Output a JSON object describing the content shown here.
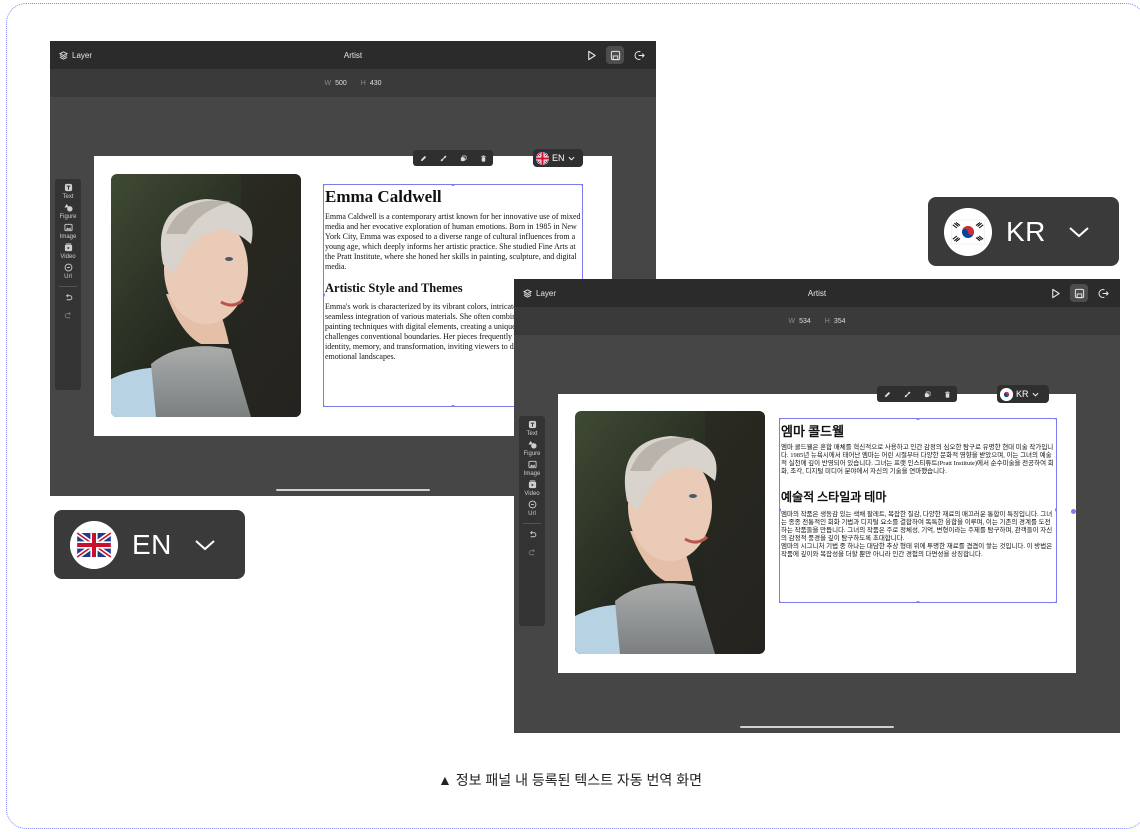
{
  "caption": "▲ 정보 패널 내 등록된 텍스트 자동 번역 화면",
  "colors": {
    "window_bg": "#464646",
    "topbar": "#2b2b2b",
    "selection": "#7c7cf0",
    "badge_bg": "#3a3a3a"
  },
  "editor_en": {
    "layer_label": "Layer",
    "title": "Artist",
    "icons": [
      "layer-icon",
      "play-icon",
      "save-icon",
      "exit-icon"
    ],
    "dims": {
      "w_label": "W",
      "w": "500",
      "h_label": "H",
      "h": "430"
    },
    "tools": [
      {
        "label": "Text",
        "icon": "text-tool-icon"
      },
      {
        "label": "Figure",
        "icon": "figure-tool-icon"
      },
      {
        "label": "Image",
        "icon": "image-tool-icon"
      },
      {
        "label": "Video",
        "icon": "video-tool-icon"
      },
      {
        "label": "Url",
        "icon": "url-tool-icon"
      }
    ],
    "lang": "EN",
    "heading": "Emma Caldwell",
    "bio": "Emma Caldwell is a contemporary artist known for her innovative use of mixed media and her evocative exploration of human emotions. Born in 1985 in New York City, Emma was exposed to a diverse range of cultural influences from a young age, which deeply informs her artistic practice. She studied Fine Arts at the Pratt Institute, where she honed her skills in painting, sculpture, and digital media.",
    "subheading": "Artistic Style and Themes",
    "style_text": "Emma's work is characterized by its vibrant colors, intricate textures, and the seamless integration of various materials. She often combines traditional painting techniques with digital elements, creating a unique fusion that challenges conventional boundaries. Her pieces frequently explore themes of identity, memory, and transformation, inviting viewers to delve into their own emotional landscapes."
  },
  "editor_kr": {
    "layer_label": "Layer",
    "title": "Artist",
    "dims": {
      "w_label": "W",
      "w": "534",
      "h_label": "H",
      "h": "354"
    },
    "tools": [
      {
        "label": "Text",
        "icon": "text-tool-icon"
      },
      {
        "label": "Figure",
        "icon": "figure-tool-icon"
      },
      {
        "label": "Image",
        "icon": "image-tool-icon"
      },
      {
        "label": "Video",
        "icon": "video-tool-icon"
      },
      {
        "label": "Url",
        "icon": "url-tool-icon"
      }
    ],
    "lang": "KR",
    "heading": "엠마 콜드웰",
    "bio": "엠마 콜드웰은 혼합 매체를 혁신적으로 사용하고 인간 감정의 심오한 탐구로 유명한 현대 미술 작가입니다. 1985년 뉴욕시에서 태어난 엠마는 어린 시절부터 다양한 문화적 영향을 받았으며, 이는 그녀의 예술적 실천에 깊이 반영되어 있습니다. 그녀는 프랫 인스티튜트(Pratt Institute)에서 순수미술을 전공하여 회화, 조각, 디지털 미디어 분야에서 자신의 기술을 연마했습니다.",
    "subheading": "예술적 스타일과 테마",
    "style_text": "엠마의 작품은 생동감 있는 색채 팔레트, 복잡한 질감, 다양한 재료의 매끄러운 통합이 특징입니다. 그녀는 종종 전통적인 회화 기법과 디지털 요소를 결합하여 독특한 융합을 이루며, 이는 기존의 경계를 도전하는 작품들을 만듭니다. 그녀의 작품은 주로 정체성, 기억, 변형이라는 주제를 탐구하며, 관객들이 자신의 감정적 풍경을 깊이 탐구하도록 초대합니다.",
    "style_text_2": "엠마의 시그니처 기법 중 하나는 대담한 추상 형태 위에 투명한 재료를 겹겹이 쌓는 것입니다. 이 방법은 작품에 깊이와 복잡성을 더할 뿐만 아니라 인간 경험의 다면성을 상징합니다."
  },
  "badge_en": {
    "code": "EN",
    "flag": "uk-flag-icon"
  },
  "badge_kr": {
    "code": "KR",
    "flag": "korea-flag-icon"
  }
}
